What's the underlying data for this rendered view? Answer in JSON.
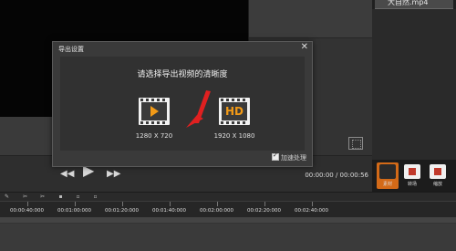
{
  "side_panel": {
    "file_name": "大自然.mp4",
    "tools": [
      {
        "label": "素材",
        "icon": "camera-icon"
      },
      {
        "label": "转场",
        "icon": "transition-icon"
      },
      {
        "label": "缩放",
        "icon": "zoom-icon"
      }
    ]
  },
  "player": {
    "prev_icon": "◀◀",
    "play_icon": "▶",
    "next_icon": "▶▶",
    "timecode": "00:00:00 / 00:00:56"
  },
  "timeline": {
    "ticks": [
      "00:00:40:000",
      "00:01:00:000",
      "00:01:20:000",
      "00:01:40:000",
      "00:02:00:000",
      "00:02:20:000",
      "00:02:40:000"
    ]
  },
  "dialog": {
    "title": "导出设置",
    "close_icon": "✕",
    "heading": "请选择导出视频的清晰度",
    "options": [
      {
        "label": "1280 X 720",
        "icon": "film-play-icon"
      },
      {
        "label": "1920 X 1080",
        "icon": "film-hd-icon",
        "badge": "HD"
      }
    ],
    "accelerate_label": "加速处理",
    "accelerate_checked": true
  },
  "colors": {
    "accent": "#f29a17",
    "arrow": "#e02020",
    "active_tool": "#d36a18"
  }
}
